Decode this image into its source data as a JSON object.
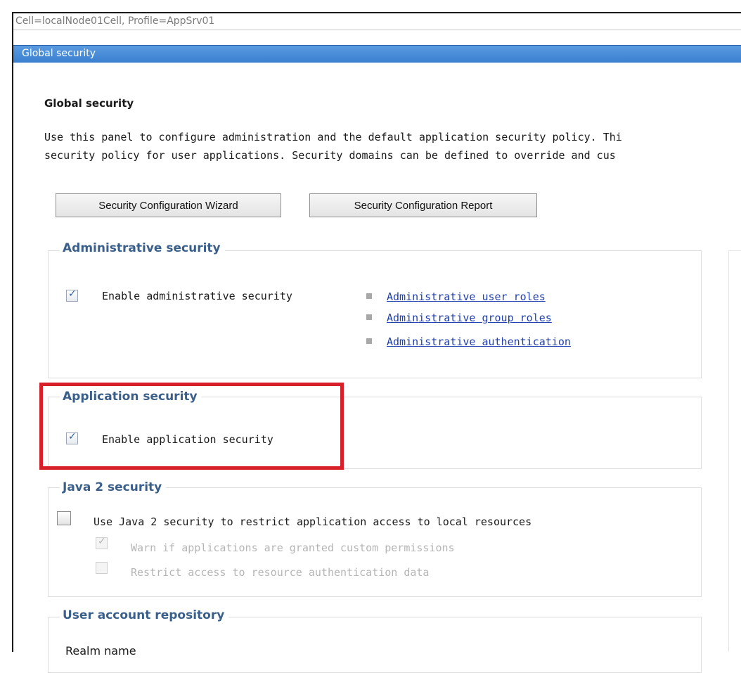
{
  "breadcrumb": "Cell=localNode01Cell, Profile=AppSrv01",
  "titlebar": "Global security",
  "panel": {
    "heading": "Global security",
    "description_line1": "Use this panel to configure administration and the default application security policy. Thi",
    "description_line2": "security policy for user applications. Security domains can be defined to override and cus"
  },
  "buttons": {
    "wizard": "Security Configuration Wizard",
    "report": "Security Configuration Report"
  },
  "admin_security": {
    "legend": "Administrative security",
    "enable_label": "Enable administrative security",
    "enable_checked": true,
    "links": [
      "Administrative user roles",
      "Administrative group roles",
      "Administrative authentication"
    ]
  },
  "app_security": {
    "legend": "Application security",
    "enable_label": "Enable application security",
    "enable_checked": true
  },
  "java2_security": {
    "legend": "Java 2 security",
    "use_label": "Use Java 2 security to restrict application access to local resources",
    "use_checked": false,
    "warn_label": "Warn if applications are granted custom permissions",
    "warn_checked": true,
    "restrict_label": "Restrict access to resource authentication data",
    "restrict_checked": false
  },
  "user_repo": {
    "legend": "User account repository",
    "realm_label": "Realm name"
  },
  "colors": {
    "titlebar": "#3a7fcf",
    "legend": "#3a5f8a",
    "link": "#1f3fb0",
    "highlight": "#d8202a"
  }
}
